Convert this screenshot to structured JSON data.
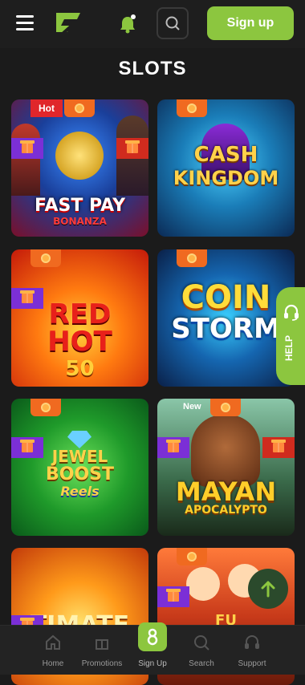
{
  "header": {
    "signup_label": "Sign up"
  },
  "page": {
    "title": "SLOTS"
  },
  "games": [
    {
      "title_line1": "FAST PAY",
      "title_line2": "BONANZA",
      "badge": "Hot"
    },
    {
      "title_line1": "CASH",
      "title_line2": "KINGDOM"
    },
    {
      "title_line1": "RED",
      "title_line2": "HOT",
      "title_line3": "50"
    },
    {
      "title_line1": "COIN",
      "title_line2": "STORM"
    },
    {
      "title_line1": "JEWEL",
      "title_line2": "BOOST",
      "title_line3": "Reels"
    },
    {
      "title_line1": "MAYAN",
      "title_line2": "APOCALYPTO",
      "badge": "New"
    },
    {
      "title_line1": "TIMATE"
    },
    {
      "title_line1": "FU"
    }
  ],
  "help": {
    "label": "HELP"
  },
  "bottom_nav": [
    {
      "label": "Home",
      "icon": "home-icon"
    },
    {
      "label": "Promotions",
      "icon": "gift-icon"
    },
    {
      "label": "Sign Up",
      "icon": "signup-icon"
    },
    {
      "label": "Search",
      "icon": "search-icon"
    },
    {
      "label": "Support",
      "icon": "headset-icon"
    }
  ],
  "colors": {
    "accent": "#8cc63f",
    "background": "#1b1b1b",
    "badge_orange": "#f06a20",
    "badge_purple": "#7b2fd6",
    "badge_red": "#e0262b"
  }
}
